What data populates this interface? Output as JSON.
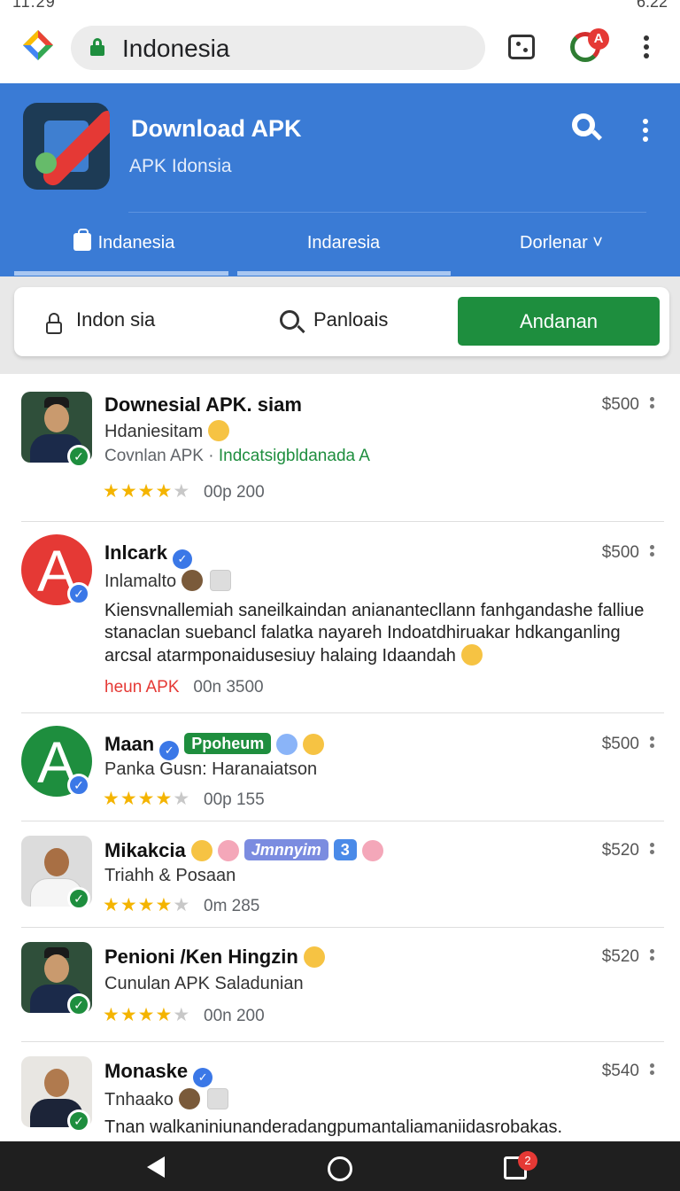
{
  "status_bar": {
    "time": "11:29",
    "right_time": "6:22"
  },
  "browser": {
    "url": "Indonesia",
    "profile_badge": "A"
  },
  "app_header": {
    "title": "Download APK",
    "subtitle": "APK Idonsia",
    "tabs": [
      {
        "label": "Indanesia"
      },
      {
        "label": "Indaresia"
      },
      {
        "label": "Dorlenar ˅"
      }
    ]
  },
  "filters": {
    "lock_label": "Indon sia",
    "search_label": "Panloais",
    "button_label": "Andanan"
  },
  "list": [
    {
      "title": "Downesial APK. siam",
      "subtitle": "Hdaniesitam",
      "meta_grey": "Covnlan APK · ",
      "meta_green": "Indcatsigbldanada A",
      "stars": 4,
      "rating_meta": "00p   200",
      "price": "$500"
    },
    {
      "title": "Inlcark",
      "subtitle": "Inlamalto",
      "description": "Kiensvnallemiah saneilkaindan anianantecllann fanhgandashe falliue stanaclan suebancl falatka nayareh Indoatdhiruakar hdkanganling arcsal atarmponaidusesiuy halaing Idaandah",
      "meta_red": "heun APK",
      "meta_grey": "00n   3500",
      "price": "$500"
    },
    {
      "title": "Maan",
      "pill": "Ppoheum",
      "subtitle": "Panka Gusn: Haranaiatson",
      "stars": 4,
      "rating_meta": "00p   155",
      "price": "$500"
    },
    {
      "title": "Mikakcia",
      "pill": "Jmnnyim",
      "pill2": "3",
      "subtitle": "Triahh & Posaan",
      "stars": 4,
      "rating_meta": "0m   285",
      "price": "$520"
    },
    {
      "title": "Penioni /Ken Hingzin",
      "subtitle": "Cunulan APK  Saladunian",
      "stars": 4,
      "rating_meta": "00n   200",
      "price": "$520"
    },
    {
      "title": "Monaske",
      "subtitle": "Tnhaako",
      "description": "Tnan walkaniniunanderadangpumantaliamaniidasrobakas.",
      "price": "$540"
    }
  ],
  "bottom_nav": {
    "recent_badge": "2"
  },
  "colors": {
    "accent": "#3a7bd5",
    "green": "#1e8e3e",
    "red": "#e53935",
    "star": "#f4b400"
  }
}
